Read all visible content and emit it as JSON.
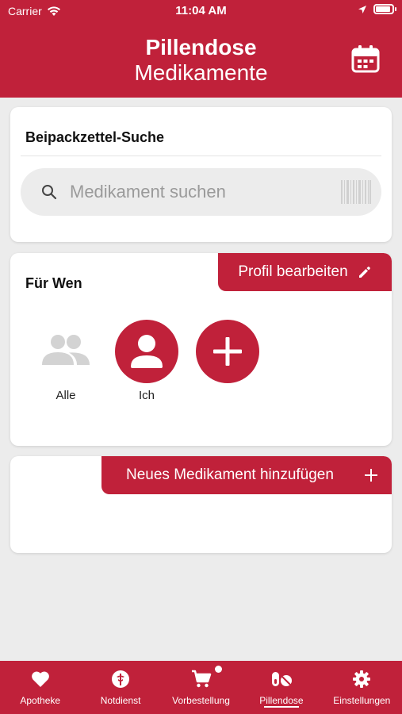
{
  "status_bar": {
    "carrier": "Carrier",
    "time": "11:04 AM"
  },
  "header": {
    "title": "Pillendose",
    "subtitle": "Medikamente",
    "calendar_icon": "calendar-icon"
  },
  "search_card": {
    "heading": "Beipackzettel-Suche",
    "placeholder": "Medikament suchen"
  },
  "profile_card": {
    "heading": "Für Wen",
    "edit_label": "Profil bearbeiten",
    "profiles": [
      {
        "label": "Alle",
        "icon": "group-icon"
      },
      {
        "label": "Ich",
        "icon": "person-icon"
      },
      {
        "label": "",
        "icon": "plus-icon"
      }
    ]
  },
  "medication_card": {
    "add_label": "Neues Medikament hinzufügen"
  },
  "tabbar": {
    "items": [
      {
        "label": "Apotheke",
        "icon": "heart-icon"
      },
      {
        "label": "Notdienst",
        "icon": "caduceus-icon"
      },
      {
        "label": "Vorbestellung",
        "icon": "cart-icon"
      },
      {
        "label": "Pillendose",
        "icon": "pills-icon",
        "active": true
      },
      {
        "label": "Einstellungen",
        "icon": "gear-icon"
      }
    ]
  },
  "colors": {
    "brand": "#c0213a",
    "background": "#ececec",
    "card": "#ffffff"
  }
}
